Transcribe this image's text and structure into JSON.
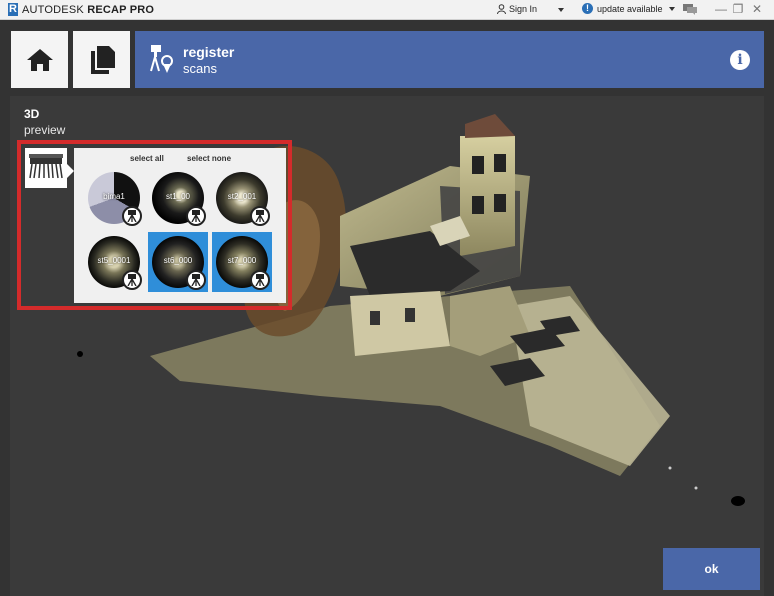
{
  "titlebar": {
    "logo_letter": "R",
    "app_name_light": "AUTODESK",
    "app_name_bold": "RECAP PRO",
    "sign_in": "Sign In",
    "update_badge": "!",
    "update": "update available",
    "minimize": "—",
    "restore": "❐",
    "close": "✕"
  },
  "nav": {
    "home_icon": "home-icon",
    "projects_icon": "copy-icon"
  },
  "banner": {
    "title": "register",
    "subtitle": "scans",
    "info": "i",
    "color": "#4a67a8"
  },
  "viewport": {
    "mode_title": "3D",
    "mode_subtitle": "preview"
  },
  "scan_panel": {
    "select_all": "select all",
    "select_none": "select none",
    "highlight_color": "#d42b2b",
    "scans": [
      {
        "label": "bima1",
        "selected": false
      },
      {
        "label": "st1_00",
        "selected": false
      },
      {
        "label": "st2_001",
        "selected": false
      },
      {
        "label": "st5_0001",
        "selected": false
      },
      {
        "label": "st6_000",
        "selected": true
      },
      {
        "label": "st7_000",
        "selected": true
      }
    ]
  },
  "ok_button": "ok"
}
